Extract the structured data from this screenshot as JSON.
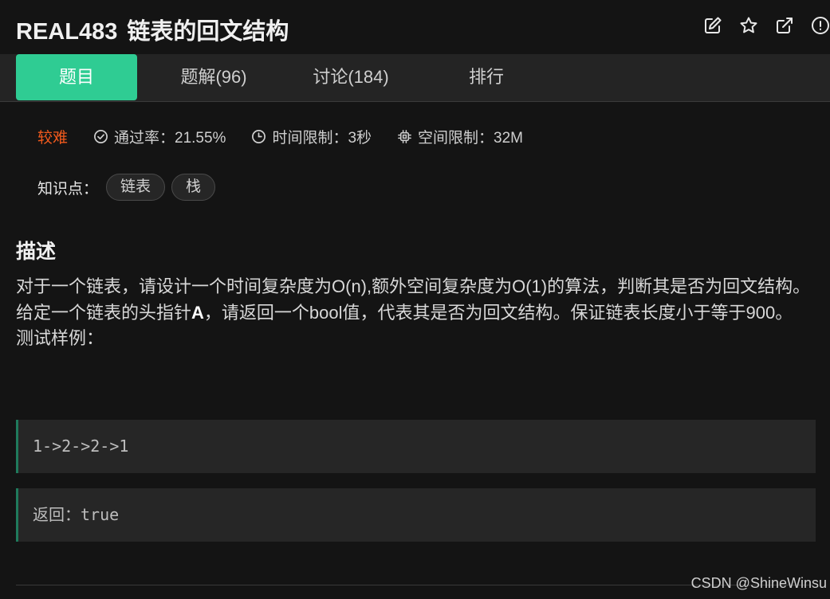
{
  "header": {
    "problem_id": "REAL483",
    "problem_title": "链表的回文结构",
    "icons": [
      "edit-icon",
      "star-icon",
      "external-link-icon",
      "report-icon"
    ]
  },
  "tabs": [
    {
      "label": "题目",
      "active": true
    },
    {
      "label": "题解(96)",
      "active": false
    },
    {
      "label": "讨论(184)",
      "active": false
    },
    {
      "label": "排行",
      "active": false
    }
  ],
  "meta": {
    "difficulty": "较难",
    "pass_rate": "通过率：21.55%",
    "time_limit": "时间限制：3秒",
    "memory_limit": "空间限制：32M"
  },
  "tags": {
    "label": "知识点：",
    "items": [
      "链表",
      "栈"
    ]
  },
  "description": {
    "heading": "描述",
    "line1": "对于一个链表，请设计一个时间复杂度为O(n),额外空间复杂度为O(1)的算法，判断其是否为回文结构。",
    "line2_pre": "给定一个链表的头指针",
    "line2_bold": "A",
    "line2_post": "，请返回一个bool值，代表其是否为回文结构。保证链表长度小于等于900。",
    "line3": "测试样例："
  },
  "examples": {
    "input": "1->2->2->1",
    "output": "返回：true"
  },
  "watermark": "CSDN @ShineWinsu",
  "colors": {
    "accent": "#2fcc93",
    "difficulty": "#f25a1d",
    "background": "#141414"
  }
}
